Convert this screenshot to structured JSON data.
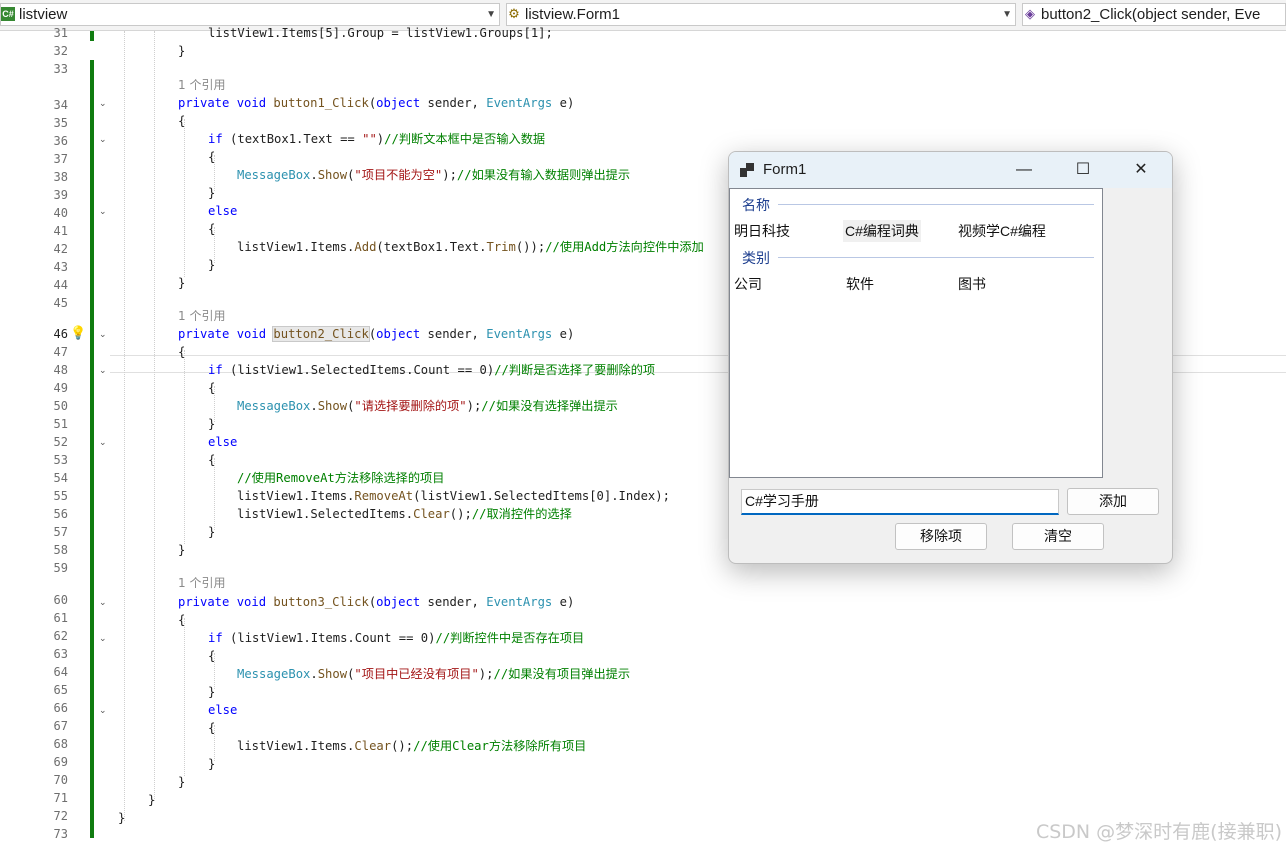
{
  "nav": {
    "project_icon": "C#",
    "project": "listview",
    "class": "listview.Form1",
    "member": "button2_Click(object sender, Eve"
  },
  "lines": [
    {
      "n": "31",
      "text": "listView1.Items[5].Group = listView1.Groups[1];"
    },
    {
      "n": "32"
    },
    {
      "n": "33"
    },
    {
      "n": "34"
    },
    {
      "n": "35"
    },
    {
      "n": "36"
    },
    {
      "n": "37"
    },
    {
      "n": "38"
    },
    {
      "n": "39"
    },
    {
      "n": "40"
    },
    {
      "n": "41"
    },
    {
      "n": "42"
    },
    {
      "n": "43"
    },
    {
      "n": "44"
    },
    {
      "n": "45"
    },
    {
      "n": "46"
    },
    {
      "n": "47"
    },
    {
      "n": "48"
    },
    {
      "n": "49"
    },
    {
      "n": "50"
    },
    {
      "n": "51"
    },
    {
      "n": "52"
    },
    {
      "n": "53"
    },
    {
      "n": "54"
    },
    {
      "n": "55"
    },
    {
      "n": "56"
    },
    {
      "n": "57"
    },
    {
      "n": "58"
    },
    {
      "n": "59"
    },
    {
      "n": "60"
    },
    {
      "n": "61"
    },
    {
      "n": "62"
    },
    {
      "n": "63"
    },
    {
      "n": "64"
    },
    {
      "n": "65"
    },
    {
      "n": "66"
    },
    {
      "n": "67"
    },
    {
      "n": "68"
    },
    {
      "n": "69"
    },
    {
      "n": "70"
    },
    {
      "n": "71"
    },
    {
      "n": "72"
    },
    {
      "n": "73"
    }
  ],
  "code": {
    "ref_label": "1 个引用",
    "kw_private": "private",
    "kw_void": "void",
    "kw_object": "object",
    "kw_if": "if",
    "kw_else": "else",
    "type_eventargs": "EventArgs",
    "type_messagebox": "MessageBox",
    "m_show": "Show",
    "m_add": "Add",
    "m_trim": "Trim",
    "m_removeat": "RemoveAt",
    "m_clear": "Clear",
    "b1": "button1_Click",
    "b2": "button2_Click",
    "b3": "button3_Click",
    "params_open": "(",
    "params_mid": " sender, ",
    "params_end": " e)",
    "brace_open": "{",
    "brace_close": "}",
    "l36_a": " (textBox1.Text == ",
    "l36_str": "\"\"",
    "l36_b": ")",
    "l36_cm": "//判断文本框中是否输入数据",
    "l38_str": "\"项目不能为空\"",
    "l38_cm": "//如果没有输入数据则弹出提示",
    "l42_a": "listView1.Items.",
    "l42_b": "(textBox1.Text.",
    "l42_c": "());",
    "l42_cm": "//使用Add方法向控件中添加",
    "l48_a": " (listView1.SelectedItems.Count == 0)",
    "l48_cm": "//判断是否选择了要删除的项",
    "l50_str": "\"请选择要删除的项\"",
    "l50_cm": "//如果没有选择弹出提示",
    "l54_cm": "//使用RemoveAt方法移除选择的项目",
    "l55_a": "listView1.Items.",
    "l55_b": "(listView1.SelectedItems[0].Index);",
    "l56_a": "listView1.SelectedItems.",
    "l56_b": "();",
    "l56_cm": "//取消控件的选择",
    "l62_a": " (listView1.Items.Count == 0)",
    "l62_cm": "//判断控件中是否存在项目",
    "l64_str": "\"项目中已经没有项目\"",
    "l64_cm": "//如果没有项目弹出提示",
    "l68_a": "listView1.Items.",
    "l68_b": "();",
    "l68_cm": "//使用Clear方法移除所有项目",
    "show_pre": ".",
    "show_open": "(",
    "show_close": ");"
  },
  "form": {
    "title": "Form1",
    "minimize_glyph": "—",
    "maximize_glyph": "☐",
    "close_glyph": "✕",
    "groups": [
      {
        "header": "名称",
        "items": [
          "明日科技",
          "C#编程词典",
          "视频学C#编程"
        ]
      },
      {
        "header": "类别",
        "items": [
          "公司",
          "软件",
          "图书"
        ]
      }
    ],
    "textbox_value": "C#学习手册",
    "add_button": "添加",
    "remove_button": "移除项",
    "clear_button": "清空"
  },
  "watermark": "CSDN @梦深时有鹿(接兼职)",
  "colors": {
    "green_change_bar": "#107c10",
    "keyword": "#0000ff",
    "type": "#2b91af",
    "string": "#a31515",
    "comment": "#008000"
  }
}
